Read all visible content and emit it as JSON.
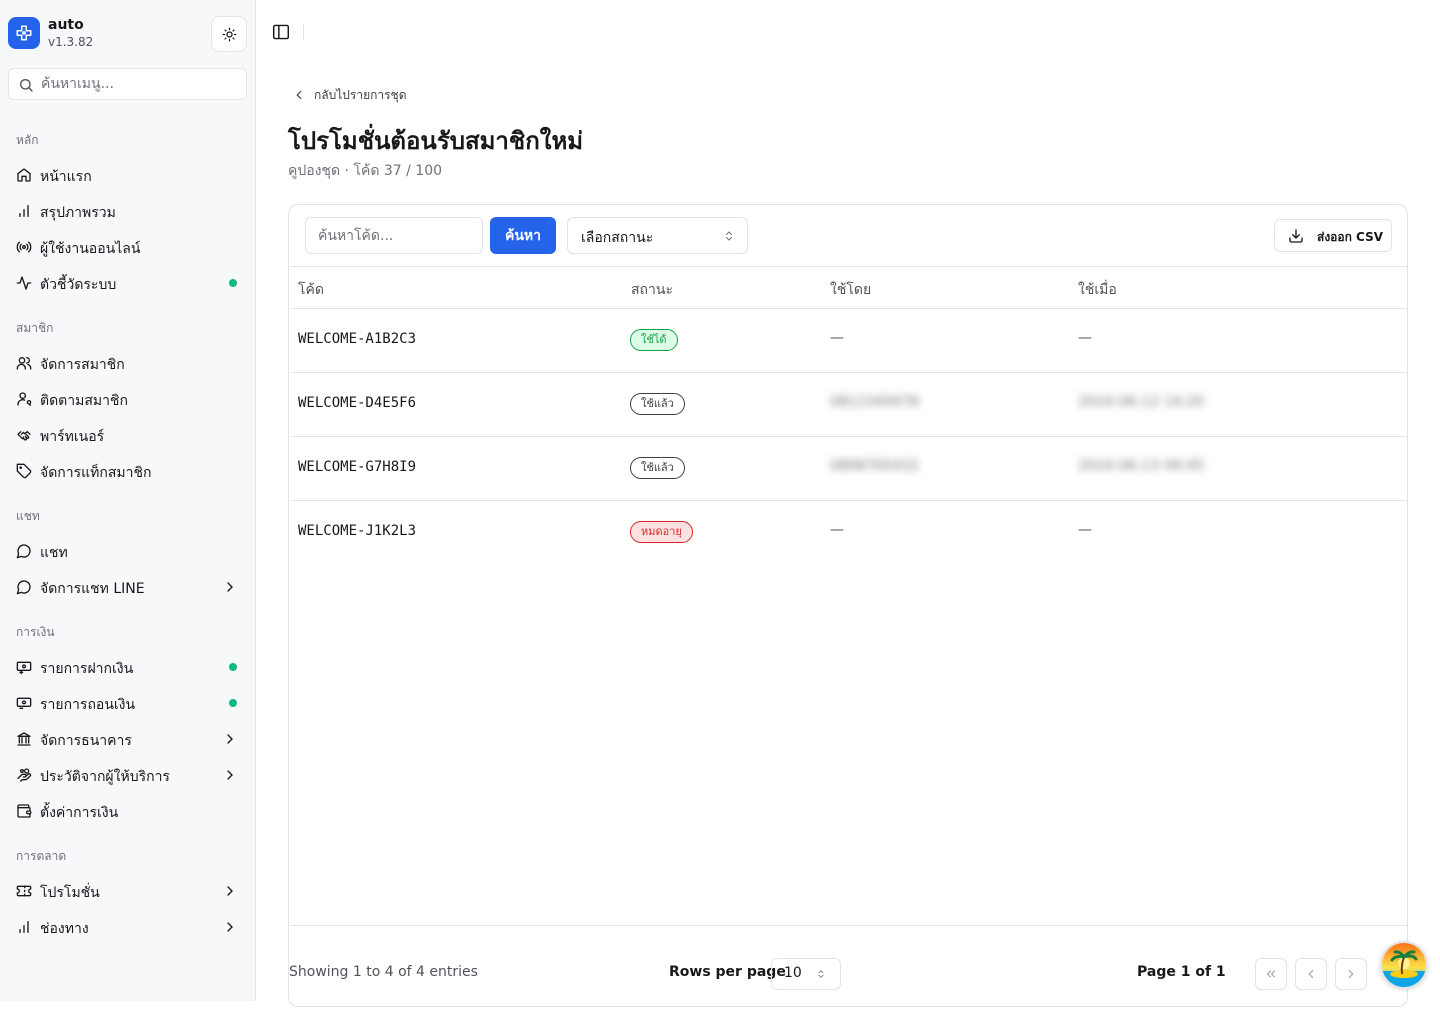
{
  "app": {
    "name": "auto",
    "version": "v1.3.82"
  },
  "sidebar": {
    "search_placeholder": "ค้นหาเมนู...",
    "sections": [
      {
        "label": "หลัก",
        "items": [
          {
            "label": "หน้าแรก",
            "icon": "home-icon"
          },
          {
            "label": "สรุปภาพรวม",
            "icon": "bar-chart-icon"
          },
          {
            "label": "ผู้ใช้งานออนไลน์",
            "icon": "radio-icon"
          },
          {
            "label": "ตัวชี้วัดระบบ",
            "icon": "activity-icon",
            "status_dot": true
          }
        ]
      },
      {
        "label": "สมาชิก",
        "items": [
          {
            "label": "จัดการสมาชิก",
            "icon": "users-icon"
          },
          {
            "label": "ติดตามสมาชิก",
            "icon": "user-search-icon"
          },
          {
            "label": "พาร์ทเนอร์",
            "icon": "handshake-icon"
          },
          {
            "label": "จัดการแท็กสมาชิก",
            "icon": "tag-icon"
          }
        ]
      },
      {
        "label": "แชท",
        "items": [
          {
            "label": "แชท",
            "icon": "chat-icon"
          },
          {
            "label": "จัดการแชท LINE",
            "icon": "chat-icon",
            "has_submenu": true
          }
        ]
      },
      {
        "label": "การเงิน",
        "items": [
          {
            "label": "รายการฝากเงิน",
            "icon": "deposit-icon",
            "status_dot": true
          },
          {
            "label": "รายการถอนเงิน",
            "icon": "withdraw-icon",
            "status_dot": true
          },
          {
            "label": "จัดการธนาคาร",
            "icon": "bank-icon",
            "has_submenu": true
          },
          {
            "label": "ประวัติจากผู้ให้บริการ",
            "icon": "hand-coins-icon",
            "has_submenu": true
          },
          {
            "label": "ตั้งค่าการเงิน",
            "icon": "wallet-icon"
          }
        ]
      },
      {
        "label": "การตลาด",
        "items": [
          {
            "label": "โปรโมชั่น",
            "icon": "ticket-icon",
            "has_submenu": true
          },
          {
            "label": "ช่องทาง",
            "icon": "bar-chart-icon",
            "has_submenu": true
          }
        ]
      }
    ]
  },
  "page": {
    "back_label": "กลับไปรายการชุด",
    "title": "โปรโมชั่นต้อนรับสมาชิกใหม่",
    "subtitle": "คูปองชุด · โค้ด 37 / 100"
  },
  "toolbar": {
    "code_search_placeholder": "ค้นหาโค้ด...",
    "search_label": "ค้นหา",
    "status_placeholder": "เลือกสถานะ",
    "export_label": "ส่งออก CSV"
  },
  "table": {
    "columns": [
      "โค้ด",
      "สถานะ",
      "ใช้โดย",
      "ใช้เมื่อ"
    ],
    "rows": [
      {
        "code": "WELCOME-A1B2C3",
        "status": "ใช้ได้",
        "status_kind": "available",
        "used_by": "—",
        "used_at": "—"
      },
      {
        "code": "WELCOME-D4E5F6",
        "status": "ใช้แล้ว",
        "status_kind": "used",
        "used_by": "0812345678",
        "used_at": "2024-06-12 14:20"
      },
      {
        "code": "WELCOME-G7H8I9",
        "status": "ใช้แล้ว",
        "status_kind": "used",
        "used_by": "0898765432",
        "used_at": "2024-06-13 09:45"
      },
      {
        "code": "WELCOME-J1K2L3",
        "status": "หมดอายุ",
        "status_kind": "expired",
        "used_by": "—",
        "used_at": "—"
      }
    ]
  },
  "pagination": {
    "info": "Showing 1 to 4 of 4 entries",
    "rows_per_page_label": "Rows per page",
    "rows_per_page": "10",
    "page_label": "Page 1 of 1"
  },
  "colors": {
    "accent": "#2563eb",
    "status_dot": "#10b981"
  }
}
